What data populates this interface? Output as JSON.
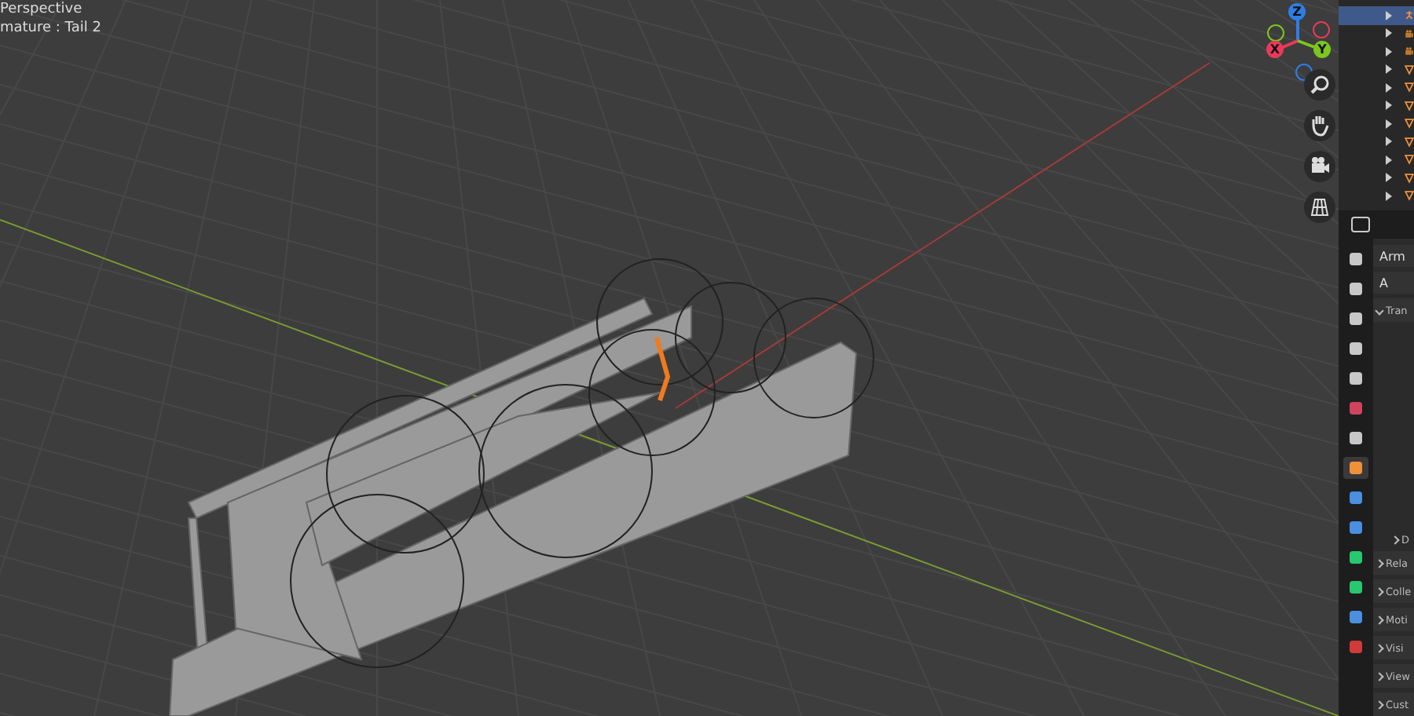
{
  "viewport": {
    "view_label": "Perspective",
    "object_label": "mature : Tail 2",
    "gizmo_axes": [
      {
        "label": "Z",
        "color": "#2e7ee6"
      },
      {
        "label": "X",
        "color": "#e83a5a"
      },
      {
        "label": "Y",
        "color": "#7cc61e"
      }
    ]
  },
  "outliner": {
    "rows": [
      {
        "kind": "armature",
        "selected": true
      },
      {
        "kind": "camera",
        "selected": false
      },
      {
        "kind": "camera",
        "selected": false
      },
      {
        "kind": "mesh",
        "selected": false
      },
      {
        "kind": "mesh",
        "selected": false
      },
      {
        "kind": "mesh",
        "selected": false
      },
      {
        "kind": "mesh",
        "selected": false
      },
      {
        "kind": "mesh",
        "selected": false
      },
      {
        "kind": "mesh",
        "selected": false
      },
      {
        "kind": "mesh",
        "selected": false
      },
      {
        "kind": "mesh",
        "selected": false
      }
    ]
  },
  "properties": {
    "tabs": [
      {
        "color": "#c8c8c8",
        "selected": false
      },
      {
        "color": "#c8c8c8",
        "selected": false
      },
      {
        "color": "#c8c8c8",
        "selected": false
      },
      {
        "color": "#c8c8c8",
        "selected": false
      },
      {
        "color": "#c8c8c8",
        "selected": false
      },
      {
        "color": "#d0455e",
        "selected": false
      },
      {
        "color": "#c8c8c8",
        "selected": false
      },
      {
        "color": "#f0913a",
        "selected": true
      },
      {
        "color": "#4a8fe0",
        "selected": false
      },
      {
        "color": "#4a8fe0",
        "selected": false
      },
      {
        "color": "#27c870",
        "selected": false
      },
      {
        "color": "#27c870",
        "selected": false
      },
      {
        "color": "#4a8fe0",
        "selected": false
      },
      {
        "color": "#d03a3a",
        "selected": false
      }
    ],
    "name_field": "Arm",
    "data_field": "A",
    "panels": [
      {
        "label": "Tran",
        "expanded": true,
        "children": [
          {
            "label": "D",
            "expanded": false
          }
        ]
      },
      {
        "label": "Rela",
        "expanded": false
      },
      {
        "label": "Colle",
        "expanded": false
      },
      {
        "label": "Moti",
        "expanded": false
      },
      {
        "label": "Visi",
        "expanded": false
      },
      {
        "label": "View",
        "expanded": false
      },
      {
        "label": "Cust",
        "expanded": false
      }
    ]
  }
}
